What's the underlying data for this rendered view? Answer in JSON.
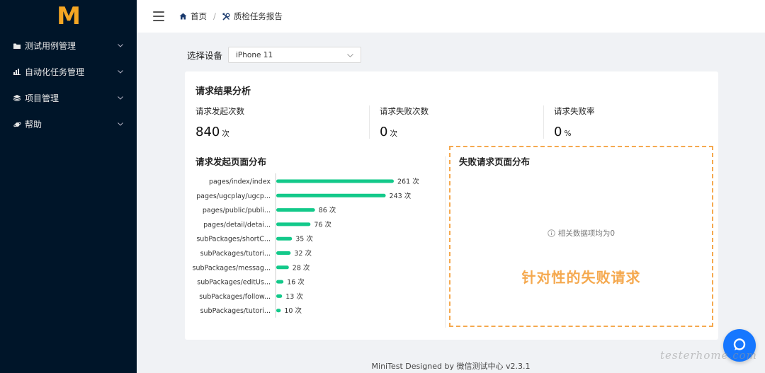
{
  "sidebar": {
    "logo": "M",
    "items": [
      {
        "label": "测试用例管理",
        "icon": "folder-icon"
      },
      {
        "label": "自动化任务管理",
        "icon": "bar-chart-icon"
      },
      {
        "label": "项目管理",
        "icon": "layers-icon"
      },
      {
        "label": "帮助",
        "icon": "planet-icon"
      }
    ]
  },
  "header": {
    "breadcrumb": [
      {
        "label": "首页",
        "icon": "home-icon"
      },
      {
        "label": "质检任务报告",
        "icon": "tools-icon"
      }
    ]
  },
  "device_select": {
    "label": "选择设备",
    "value": "iPhone 11"
  },
  "report": {
    "title": "请求结果分析",
    "stats": [
      {
        "label": "请求发起次数",
        "value": "840",
        "unit": "次"
      },
      {
        "label": "请求失败次数",
        "value": "0",
        "unit": "次"
      },
      {
        "label": "请求失败率",
        "value": "0",
        "unit": "%"
      }
    ],
    "distribution_title": "请求发起页面分布",
    "failed_title": "失败请求页面分布",
    "empty_text": "相关数据项均为0",
    "annotation": "针对性的失败请求"
  },
  "chart_data": {
    "type": "bar",
    "orientation": "horizontal",
    "categories": [
      "pages/index/index",
      "pages/ugcplay/ugcp...",
      "pages/public/publi...",
      "pages/detail/detai...",
      "subPackages/shortC...",
      "subPackages/tutori...",
      "subPackages/messag...",
      "subPackages/editUs...",
      "subPackages/follow...",
      "subPackages/tutori..."
    ],
    "values": [
      261,
      243,
      86,
      76,
      35,
      32,
      28,
      16,
      13,
      10
    ],
    "value_suffix": " 次",
    "color": "#13c98a"
  },
  "footer": "MiniTest Designed by 微信测试中心 v2.3.1",
  "watermark": "testerhome.com",
  "colors": {
    "sidebar_bg": "#001529",
    "logo": "#f5a623",
    "bar": "#13c98a",
    "annotation": "#f5a94f",
    "chat_button": "#1677ff"
  }
}
